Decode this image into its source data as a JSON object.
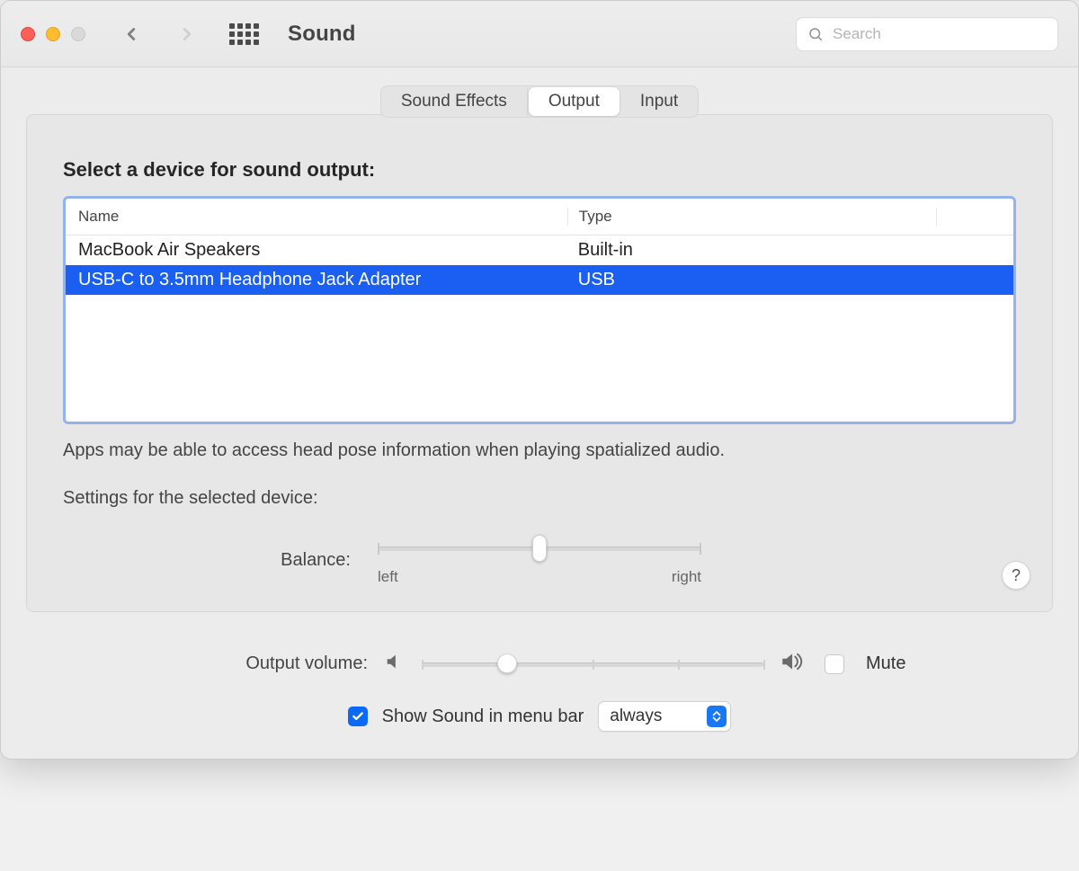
{
  "toolbar": {
    "title": "Sound",
    "search_placeholder": "Search"
  },
  "tabs": {
    "items": [
      "Sound Effects",
      "Output",
      "Input"
    ],
    "active_index": 1
  },
  "output": {
    "section_title": "Select a device for sound output:",
    "columns": {
      "name": "Name",
      "type": "Type"
    },
    "devices": [
      {
        "name": "MacBook Air Speakers",
        "type": "Built-in",
        "selected": false
      },
      {
        "name": "USB-C to 3.5mm Headphone Jack Adapter",
        "type": "USB",
        "selected": true
      }
    ],
    "spatial_note": "Apps may be able to access head pose information when playing spatialized audio.",
    "settings_title": "Settings for the selected device:",
    "balance": {
      "label": "Balance:",
      "left_label": "left",
      "right_label": "right",
      "value_percent": 50
    }
  },
  "help": {
    "symbol": "?"
  },
  "volume": {
    "label": "Output volume:",
    "value_percent": 25,
    "mute_label": "Mute",
    "mute_checked": false
  },
  "menubar": {
    "show_label": "Show Sound in menu bar",
    "show_checked": true,
    "mode_selected": "always"
  }
}
